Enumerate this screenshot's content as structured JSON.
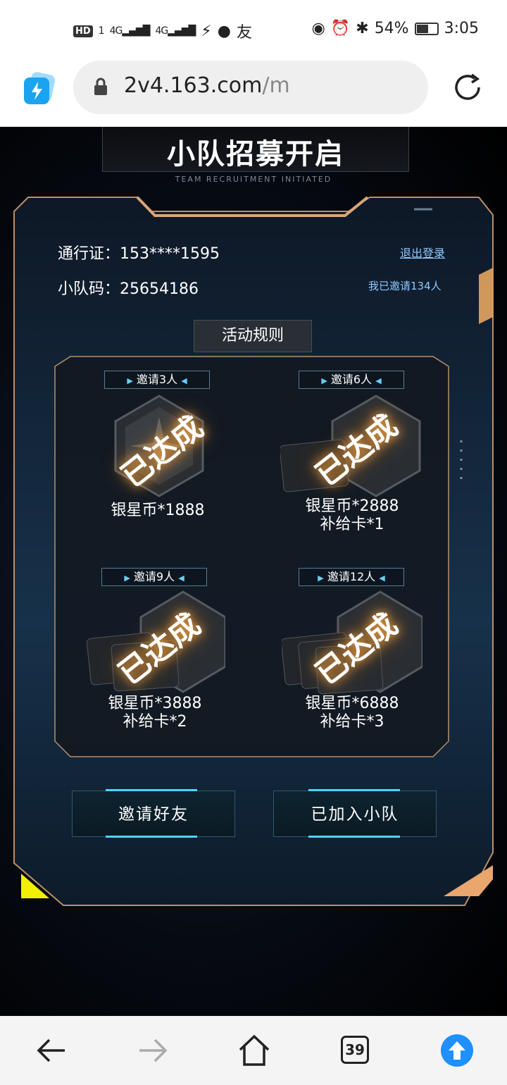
{
  "status_bar": {
    "left_hd": "HD",
    "left_sim": "1",
    "left_net1": "4G",
    "left_net2": "4G",
    "battery": "54%",
    "time": "3:05"
  },
  "browser": {
    "url_host": "2v4.163.com",
    "url_path": "/m",
    "tabs_count": "39"
  },
  "header": {
    "title": "小队招募开启",
    "subtitle": "TEAM RECRUITMENT INITIATED"
  },
  "account": {
    "pass_label": "通行证：",
    "pass_value": "153****1595",
    "team_label": "小队码：",
    "team_value": "25654186",
    "logout": "退出登录",
    "invited": "我已邀请134人"
  },
  "rules_button": "活动规则",
  "rewards": [
    {
      "tag": "邀请3人",
      "line1": "银星币*1888",
      "line2": "",
      "stamp": "已达成"
    },
    {
      "tag": "邀请6人",
      "line1": "银星币*2888",
      "line2": "补给卡*1",
      "stamp": "已达成"
    },
    {
      "tag": "邀请9人",
      "line1": "银星币*3888",
      "line2": "补给卡*2",
      "stamp": "已达成"
    },
    {
      "tag": "邀请12人",
      "line1": "银星币*6888",
      "line2": "补给卡*3",
      "stamp": "已达成"
    }
  ],
  "actions": {
    "invite": "邀请好友",
    "joined": "已加入小队"
  },
  "colors": {
    "accent_blue": "#4fd3ff",
    "gold_border": "#b8906a",
    "link": "#8fc9ff"
  }
}
